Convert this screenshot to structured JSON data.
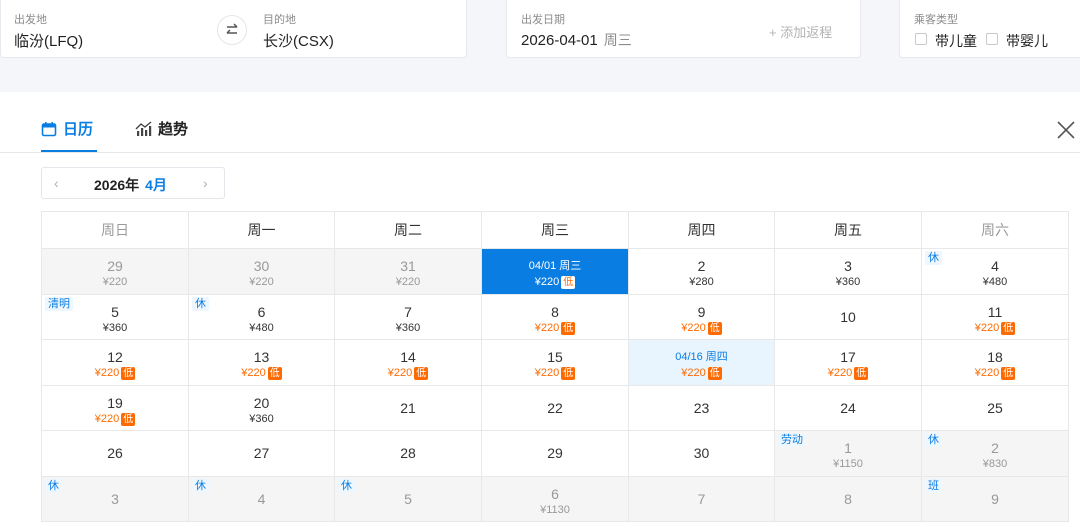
{
  "search": {
    "from_label": "出发地",
    "from_value": "临汾(LFQ)",
    "to_label": "目的地",
    "to_value": "长沙(CSX)",
    "date_label": "出发日期",
    "date_value": "2026-04-01",
    "date_weekday": "周三",
    "add_return": "+ 添加返程",
    "passenger_label": "乘客类型",
    "child_label": "带儿童",
    "infant_label": "带婴儿"
  },
  "tabs": {
    "calendar": "日历",
    "trend": "趋势"
  },
  "month_nav": {
    "year": "2026年",
    "month": "4月",
    "prev": "‹",
    "next": "›"
  },
  "weekdays": [
    "周日",
    "周一",
    "周二",
    "周三",
    "周四",
    "周五",
    "周六"
  ],
  "weeks": [
    [
      {
        "day": "29",
        "price": "¥220",
        "type": "other"
      },
      {
        "day": "30",
        "price": "¥220",
        "type": "other"
      },
      {
        "day": "31",
        "price": "¥220",
        "type": "other"
      },
      {
        "day": "04/01 周三",
        "price": "¥220",
        "low": "低",
        "type": "selected"
      },
      {
        "day": "2",
        "price": "¥280"
      },
      {
        "day": "3",
        "price": "¥360"
      },
      {
        "day": "4",
        "price": "¥480",
        "badge": "休"
      }
    ],
    [
      {
        "day": "5",
        "price": "¥360",
        "badge": "清明"
      },
      {
        "day": "6",
        "price": "¥480",
        "badge": "休"
      },
      {
        "day": "7",
        "price": "¥360"
      },
      {
        "day": "8",
        "price": "¥220",
        "low": "低"
      },
      {
        "day": "9",
        "price": "¥220",
        "low": "低"
      },
      {
        "day": "10",
        "price": ""
      },
      {
        "day": "11",
        "price": "¥220",
        "low": "低"
      }
    ],
    [
      {
        "day": "12",
        "price": "¥220",
        "low": "低"
      },
      {
        "day": "13",
        "price": "¥220",
        "low": "低"
      },
      {
        "day": "14",
        "price": "¥220",
        "low": "低"
      },
      {
        "day": "15",
        "price": "¥220",
        "low": "低"
      },
      {
        "day": "04/16 周四",
        "price": "¥220",
        "low": "低",
        "type": "ret"
      },
      {
        "day": "17",
        "price": "¥220",
        "low": "低"
      },
      {
        "day": "18",
        "price": "¥220",
        "low": "低"
      }
    ],
    [
      {
        "day": "19",
        "price": "¥220",
        "low": "低"
      },
      {
        "day": "20",
        "price": "¥360"
      },
      {
        "day": "21",
        "price": ""
      },
      {
        "day": "22",
        "price": ""
      },
      {
        "day": "23",
        "price": ""
      },
      {
        "day": "24",
        "price": ""
      },
      {
        "day": "25",
        "price": ""
      }
    ],
    [
      {
        "day": "26",
        "price": ""
      },
      {
        "day": "27",
        "price": ""
      },
      {
        "day": "28",
        "price": ""
      },
      {
        "day": "29",
        "price": ""
      },
      {
        "day": "30",
        "price": ""
      },
      {
        "day": "1",
        "price": "¥1150",
        "badge": "劳动",
        "type": "other"
      },
      {
        "day": "2",
        "price": "¥830",
        "badge": "休",
        "type": "other"
      }
    ],
    [
      {
        "day": "3",
        "price": "",
        "badge": "休",
        "type": "other"
      },
      {
        "day": "4",
        "price": "",
        "badge": "休",
        "type": "other"
      },
      {
        "day": "5",
        "price": "",
        "badge": "休",
        "type": "other"
      },
      {
        "day": "6",
        "price": "¥1130",
        "type": "other"
      },
      {
        "day": "7",
        "price": "",
        "type": "other"
      },
      {
        "day": "8",
        "price": "",
        "type": "other"
      },
      {
        "day": "9",
        "price": "",
        "badge": "班",
        "type": "other"
      }
    ]
  ],
  "colors": {
    "accent": "#0a7de3",
    "low": "#ff6a00"
  }
}
